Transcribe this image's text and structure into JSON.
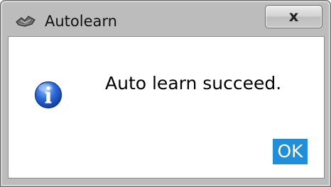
{
  "window": {
    "title": "Autolearn",
    "app_icon": "autolearn-app-icon",
    "close_glyph": "x"
  },
  "dialog": {
    "icon": "information-icon",
    "message": "Auto learn succeed.",
    "ok_label": "OK"
  },
  "colors": {
    "ok_button_bg": "#1f8fdc",
    "frame": "#bcbcbc",
    "info_icon_blue": "#1c54c4"
  }
}
